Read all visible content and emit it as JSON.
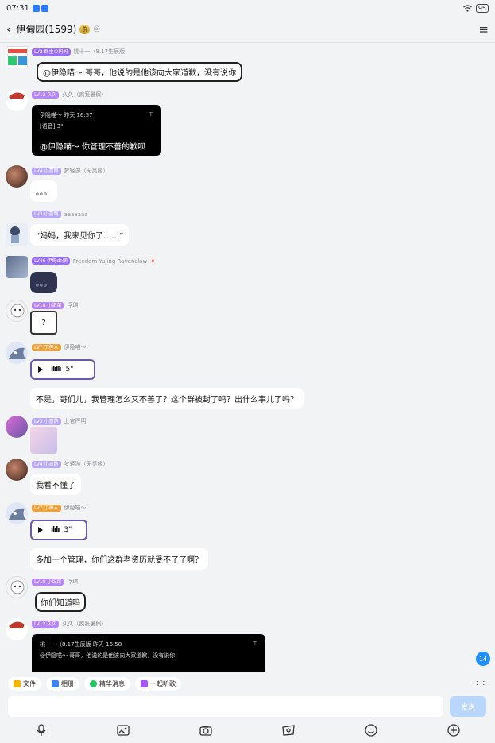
{
  "status_bar": {
    "time": "07:31",
    "battery": "95"
  },
  "header": {
    "title": "伊甸园(1599)",
    "crown_badge": "群",
    "eye_glyph": "👁"
  },
  "messages": [
    {
      "level": "LV2 群主の妈妈",
      "level_color": "#9b6bff",
      "name": "桃十一（8.17生辰版",
      "text": "@伊隐喵～ 哥哥，他说的是他该向大家道歉，没有说你"
    },
    {
      "level": "LV12 久久",
      "level_color": "#b784ff",
      "name": "久久（疯狂暑假）",
      "quote": {
        "author": "伊隐喵～ 昨天 16:57",
        "sub": "[语音] 3\"",
        "reply": "@伊隐喵～ 你管理不善的歉呗"
      }
    },
    {
      "level": "LV4 小喜鹊",
      "level_color": "#b9a6ff",
      "name": "梦轻游（无觅缘）",
      "text": "。。。"
    },
    {
      "level": "LV3 小喜鹊",
      "level_color": "#b9a6ff",
      "name": "aaaaaaa",
      "text": "“妈妈，我来见你了……”"
    },
    {
      "level": "LV46 伊甸de嫡",
      "level_color": "#9b6bff",
      "name": "Freedom YuJing Ravenclaw",
      "text": "。。。"
    },
    {
      "level": "LV18 小甜菜",
      "level_color": "#b784ff",
      "name": "浮琪",
      "text": "?"
    },
    {
      "level": "LV7 丁神人",
      "level_color": "#f2a23a",
      "name": "伊隐喵～",
      "voice_duration": "5\""
    },
    {
      "text": "不是，哥们儿，我管理怎么又不善了？这个群被封了吗？出什么事儿了吗？"
    },
    {
      "level": "LV3 小喜鹊",
      "level_color": "#b9a6ff",
      "name": "上官严明"
    },
    {
      "level": "LV4 小喜鹊",
      "level_color": "#b9a6ff",
      "name": "梦轻游（无觅缘）",
      "text": "我看不懂了"
    },
    {
      "level": "LV7 丁神人",
      "level_color": "#f2a23a",
      "name": "伊隐喵～",
      "voice_duration": "3\""
    },
    {
      "text": "多加一个管理，你们这群老资历就受不了了啊？"
    },
    {
      "level": "LV18 小甜菜",
      "level_color": "#b784ff",
      "name": "浮琪",
      "text": "你们知道吗"
    },
    {
      "level": "LV12 久久",
      "level_color": "#b784ff",
      "name": "久久（疯狂暑假）",
      "quote": {
        "author": "桃十一（8.17生辰版 昨天 16:58",
        "sub": "@伊隐喵～ 哥哥，他说的是他该向大家道歉，没有说你"
      }
    }
  ],
  "unread_count": "14",
  "chips": [
    {
      "label": "文件",
      "color": "#f5b400"
    },
    {
      "label": "相册",
      "color": "#3b82f6"
    },
    {
      "label": "精华消息",
      "color": "#22c55e"
    },
    {
      "label": "一起听歌",
      "color": "#a855f7"
    }
  ],
  "input": {
    "placeholder": "",
    "send_label": "发送"
  },
  "toolbar_icons": [
    "microphone-icon",
    "image-icon",
    "camera-icon",
    "red-packet-icon",
    "emoji-icon",
    "plus-icon"
  ]
}
